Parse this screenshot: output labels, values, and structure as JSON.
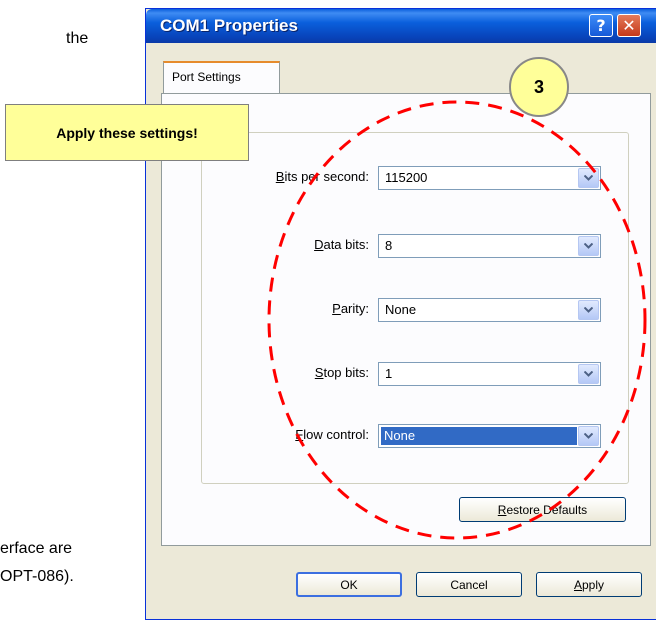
{
  "background": {
    "text_the": "the",
    "text_line1": "erface are",
    "text_line2": "OPT-086)."
  },
  "window": {
    "title": "COM1 Properties",
    "help_glyph": "?",
    "close_glyph": "✕"
  },
  "tabs": [
    {
      "label": "Port Settings",
      "active": true
    }
  ],
  "fields": [
    {
      "label_prefix": "",
      "label_ul": "B",
      "label_rest": "its per second:",
      "value": "115200",
      "selected": false
    },
    {
      "label_prefix": "",
      "label_ul": "D",
      "label_rest": "ata bits:",
      "value": "8",
      "selected": false
    },
    {
      "label_prefix": "",
      "label_ul": "P",
      "label_rest": "arity:",
      "value": "None",
      "selected": false
    },
    {
      "label_prefix": "",
      "label_ul": "S",
      "label_rest": "top bits:",
      "value": "1",
      "selected": false
    },
    {
      "label_prefix": "",
      "label_ul": "F",
      "label_rest": "low control:",
      "value": "None",
      "selected": true
    }
  ],
  "buttons": {
    "restore_ul": "R",
    "restore_rest": "estore Defaults",
    "ok": "OK",
    "cancel": "Cancel",
    "apply_ul": "A",
    "apply_rest": "pply"
  },
  "annotation": {
    "callout_text": "Apply these settings!",
    "step_number": "3",
    "callout_color": "#ffff99",
    "ellipse_color": "#ff0000"
  },
  "colors": {
    "titlebar": "#0a5fdc",
    "selection": "#316ac5",
    "tab_accent": "#e68b2c"
  }
}
